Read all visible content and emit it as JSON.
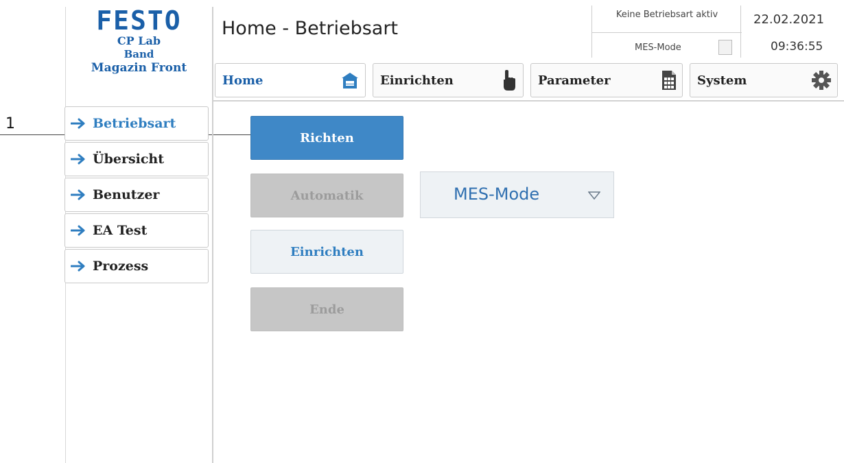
{
  "callout": {
    "number": "1"
  },
  "logo": {
    "brand": "FESTO",
    "station_line1": "CP Lab",
    "station_line2": "Band",
    "station_line3": "Magazin Front"
  },
  "header": {
    "title": "Home - Betriebsart",
    "status_mode": "Keine Betriebsart aktiv",
    "mes_mode_label": "MES-Mode",
    "mes_mode_checked": false,
    "date": "22.02.2021",
    "time": "09:36:55"
  },
  "topnav": {
    "tabs": [
      {
        "label": "Home",
        "icon": "house-icon",
        "active": true
      },
      {
        "label": "Einrichten",
        "icon": "hand-pointer-icon",
        "active": false
      },
      {
        "label": "Parameter",
        "icon": "document-grid-icon",
        "active": false
      },
      {
        "label": "System",
        "icon": "gear-icon",
        "active": false
      }
    ]
  },
  "sidebar": {
    "items": [
      {
        "label": "Betriebsart",
        "icon": "arrow-right-icon",
        "active": true
      },
      {
        "label": "Übersicht",
        "icon": "arrow-right-icon",
        "active": false
      },
      {
        "label": "Benutzer",
        "icon": "arrow-right-icon",
        "active": false
      },
      {
        "label": "EA Test",
        "icon": "arrow-right-icon",
        "active": false
      },
      {
        "label": "Prozess",
        "icon": "arrow-right-icon",
        "active": false
      }
    ]
  },
  "main": {
    "buttons": {
      "richten": "Richten",
      "automatik": "Automatik",
      "einrichten": "Einrichten",
      "ende": "Ende"
    },
    "mode_dropdown": {
      "value": "MES-Mode",
      "icon": "triangle-down-icon"
    }
  },
  "colors": {
    "brand_blue": "#1a5fa8",
    "accent_blue": "#3f88c7",
    "disabled_gray": "#c6c6c6",
    "light_panel": "#eef2f5"
  }
}
